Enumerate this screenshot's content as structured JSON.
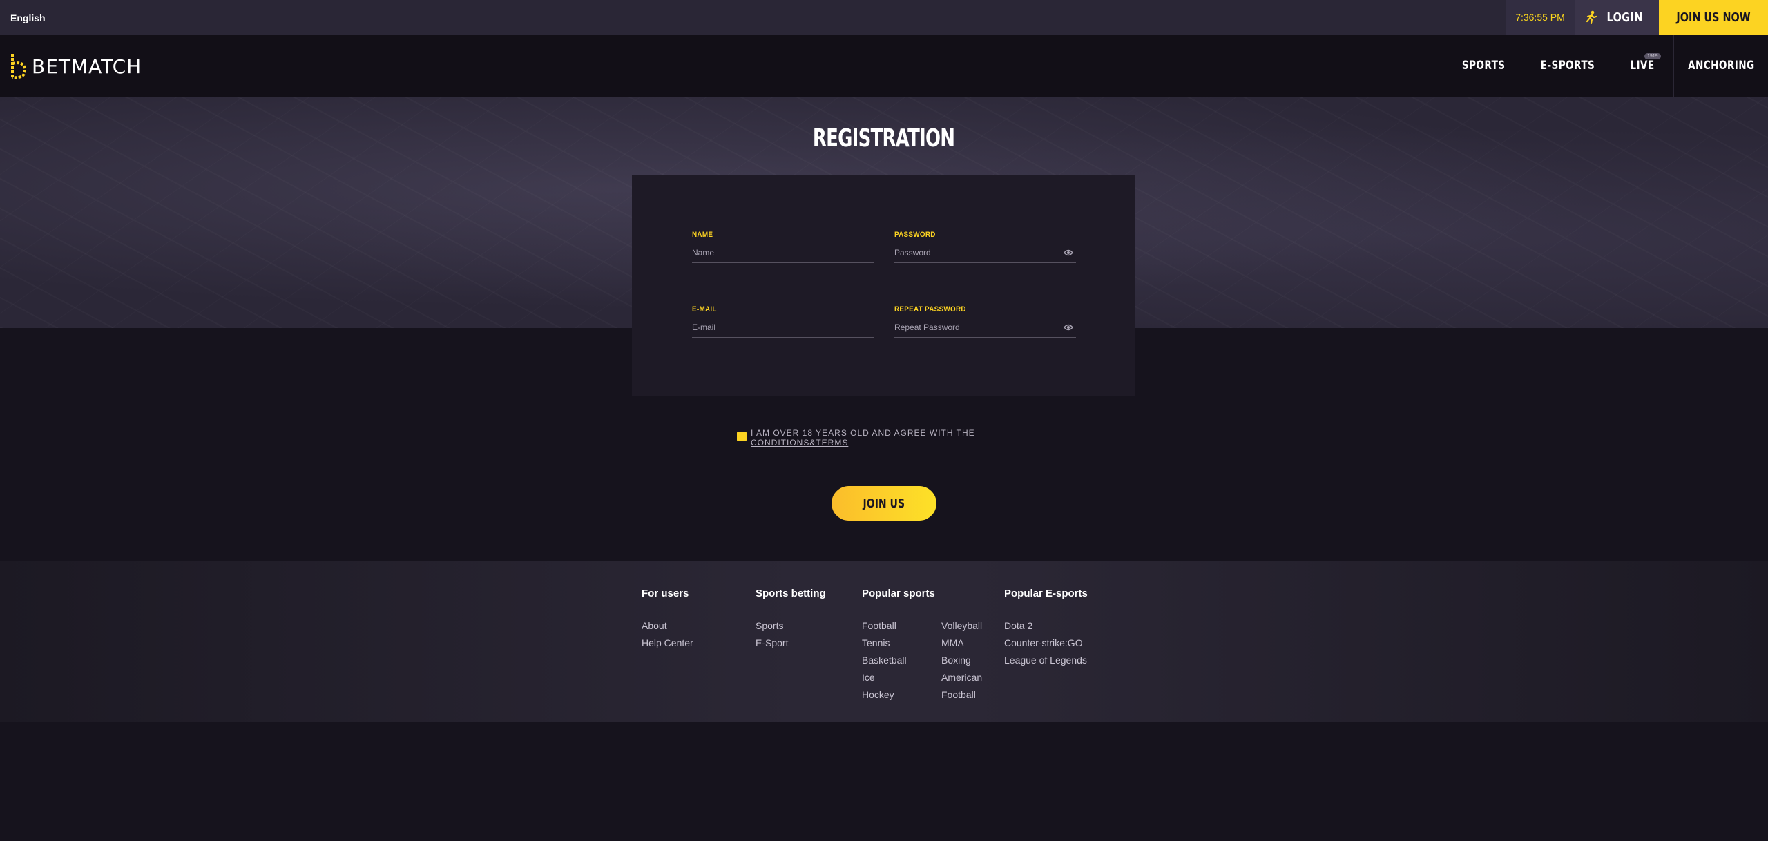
{
  "topbar": {
    "language": "English",
    "time": "7:36:55 PM",
    "login_label": "LOGIN",
    "join_now_label": "JOIN US NOW"
  },
  "header": {
    "brand": "BETMATCH",
    "nav": [
      {
        "label": "SPORTS"
      },
      {
        "label": "E-SPORTS"
      },
      {
        "label": "LIVE",
        "badge": "1919"
      },
      {
        "label": "ANCHORING"
      }
    ]
  },
  "registration": {
    "title": "REGISTRATION",
    "fields": {
      "name": {
        "label": "NAME",
        "placeholder": "Name"
      },
      "password": {
        "label": "PASSWORD",
        "placeholder": "Password"
      },
      "email": {
        "label": "E-MAIL",
        "placeholder": "E-mail"
      },
      "repeat_password": {
        "label": "REPEAT PASSWORD",
        "placeholder": "Repeat Password"
      }
    },
    "agree_text": "I AM OVER 18 YEARS OLD AND AGREE WITH THE",
    "terms_link": "CONDITIONS&TERMS",
    "submit_label": "JOIN US"
  },
  "footer": {
    "for_users": {
      "title": "For users",
      "links": [
        "About",
        "Help Center"
      ]
    },
    "sports_betting": {
      "title": "Sports betting",
      "links": [
        "Sports",
        "E-Sport"
      ]
    },
    "popular_sports": {
      "title": "Popular sports",
      "col1": [
        "Football",
        "Tennis",
        "Basketball",
        "Ice",
        "Hockey"
      ],
      "col2": [
        "Volleyball",
        "MMA",
        "Boxing",
        "American",
        "Football"
      ]
    },
    "popular_esports": {
      "title": "Popular E-sports",
      "links": [
        "Dota 2",
        "Counter-strike:GO",
        "League of Legends"
      ]
    }
  },
  "colors": {
    "accent": "#fcd322",
    "background": "#16131d",
    "topbar": "#2a2636",
    "header": "#120f17"
  },
  "icons": {
    "login": "running-person-icon",
    "password_toggle": "eye-icon",
    "logo": "betmatch-logo-icon"
  }
}
